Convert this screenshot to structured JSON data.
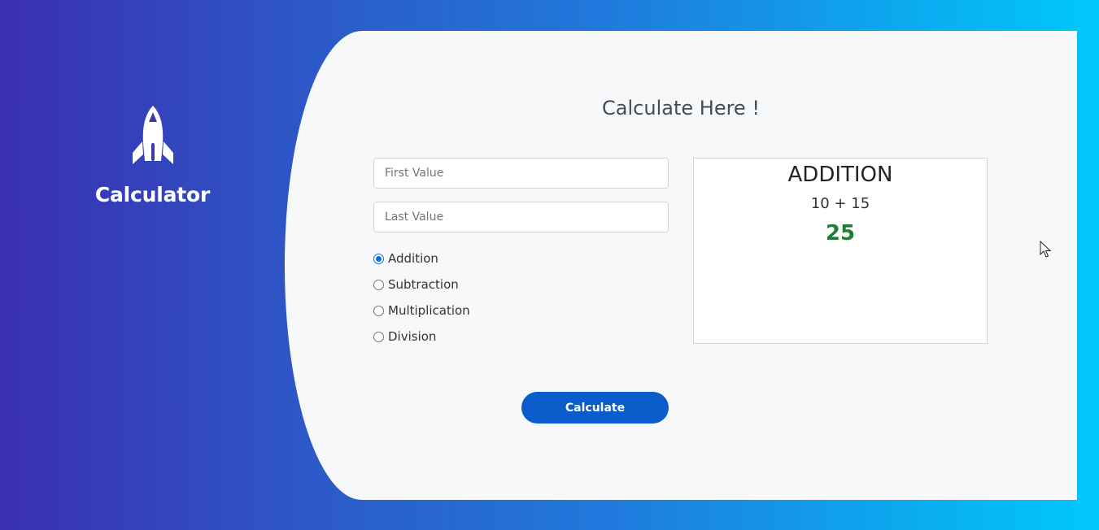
{
  "sidebar": {
    "app_title": "Calculator",
    "logo_icon": "rocket-icon"
  },
  "main": {
    "heading": "Calculate Here !",
    "form": {
      "first_value": {
        "value": "",
        "placeholder": "First Value"
      },
      "last_value": {
        "value": "",
        "placeholder": "Last Value"
      },
      "operations": [
        {
          "label": "Addition",
          "selected": true
        },
        {
          "label": "Subtraction",
          "selected": false
        },
        {
          "label": "Multiplication",
          "selected": false
        },
        {
          "label": "Division",
          "selected": false
        }
      ],
      "submit_label": "Calculate"
    },
    "result": {
      "operation": "ADDITION",
      "expression": "10 + 15",
      "value": "25"
    }
  },
  "colors": {
    "gradient_start": "#3a2fb0",
    "gradient_end": "#00c8fd",
    "button": "#0b5ccb",
    "result_value": "#1f7d34",
    "radio_selected": "#0b6ee8"
  }
}
